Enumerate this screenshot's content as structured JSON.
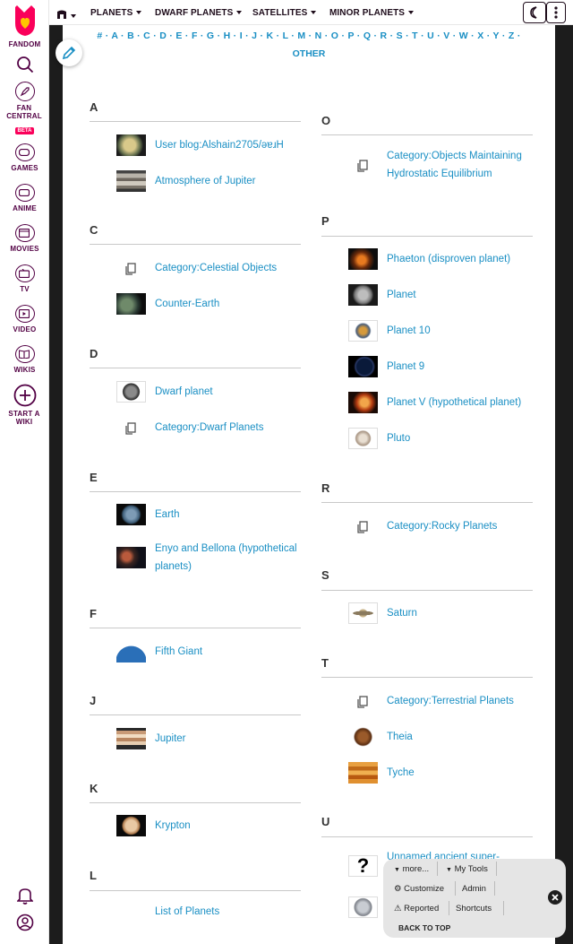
{
  "rail": {
    "items": [
      {
        "label": "FANDOM"
      },
      {
        "label": "FAN CENTRAL"
      },
      {
        "label": "GAMES"
      },
      {
        "label": "ANIME"
      },
      {
        "label": "MOVIES"
      },
      {
        "label": "TV"
      },
      {
        "label": "VIDEO"
      },
      {
        "label": "WIKIS"
      },
      {
        "label": "START A WIKI"
      }
    ],
    "beta_badge": "BETA"
  },
  "topnav": {
    "items": [
      {
        "label": "PLANETS"
      },
      {
        "label": "DWARF PLANETS"
      },
      {
        "label": "SATELLITES"
      },
      {
        "label": "MINOR PLANETS"
      }
    ]
  },
  "index": {
    "alphabet": "# · A · B · C · D · E · F · G · H · I · J · K · L · M · N · O · P · Q · R · S · T · U · V · W · X · Y · Z ·",
    "other": "OTHER"
  },
  "left_sections": [
    {
      "letter": "A",
      "entries": [
        "User blog:Alshain2705/əɐɹH",
        "Atmosphere of Jupiter"
      ]
    },
    {
      "letter": "C",
      "entries": [
        "Category:Celestial Objects",
        "Counter-Earth"
      ]
    },
    {
      "letter": "D",
      "entries": [
        "Dwarf planet",
        "Category:Dwarf Planets"
      ]
    },
    {
      "letter": "E",
      "entries": [
        "Earth",
        "Enyo and Bellona (hypothetical planets)"
      ]
    },
    {
      "letter": "F",
      "entries": [
        "Fifth Giant"
      ]
    },
    {
      "letter": "J",
      "entries": [
        "Jupiter"
      ]
    },
    {
      "letter": "K",
      "entries": [
        "Krypton"
      ]
    },
    {
      "letter": "L",
      "entries": [
        "List of Planets"
      ]
    }
  ],
  "right_sections": [
    {
      "letter": "O",
      "entries": [
        "Category:Objects Maintaining Hydrostatic Equilibrium"
      ]
    },
    {
      "letter": "P",
      "entries": [
        "Phaeton (disproven planet)",
        "Planet",
        "Planet 10",
        "Planet 9",
        "Planet V (hypothetical planet)",
        "Pluto"
      ]
    },
    {
      "letter": "R",
      "entries": [
        "Category:Rocky Planets"
      ]
    },
    {
      "letter": "S",
      "entries": [
        "Saturn"
      ]
    },
    {
      "letter": "T",
      "entries": [
        "Category:Terrestrial Planets",
        "Theia",
        "Tyche"
      ]
    },
    {
      "letter": "U",
      "entries": [
        "Unnamed ancient super-",
        ""
      ]
    }
  ],
  "toolbar": {
    "more": "more...",
    "my_tools": "My Tools",
    "customize": "Customize",
    "admin": "Admin",
    "reported": "Reported",
    "shortcuts": "Shortcuts",
    "back_to_top": "BACK TO TOP"
  },
  "colors": {
    "link": "#1a8fc4",
    "brand": "#fa005a",
    "rail_text": "#520044"
  }
}
